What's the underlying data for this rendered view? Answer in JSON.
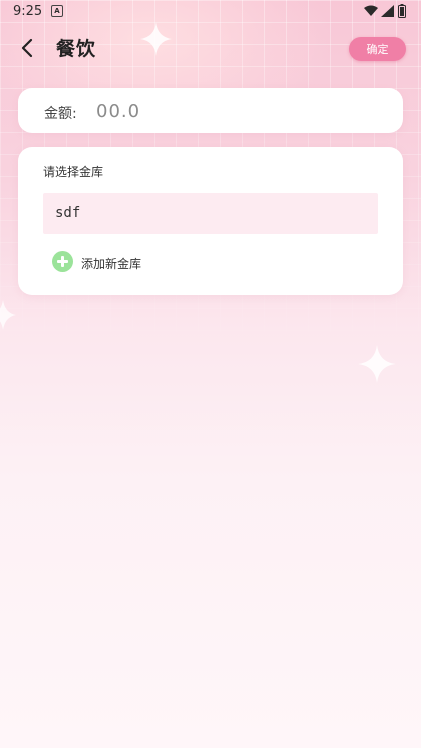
{
  "status_bar": {
    "time": "9:25",
    "notification_icon": "a-notification-icon",
    "wifi_icon": "wifi-icon",
    "signal_icon": "signal-icon",
    "battery_icon": "battery-icon"
  },
  "header": {
    "back_icon": "chevron-left-icon",
    "title": "餐饮",
    "confirm_label": "确定"
  },
  "amount": {
    "label": "金额:",
    "placeholder": "00.0",
    "value": ""
  },
  "vault": {
    "heading": "请选择金库",
    "items": [
      {
        "label": "sdf",
        "selected": true
      }
    ],
    "add_label": "添加新金库",
    "add_icon": "plus-circle-icon"
  },
  "colors": {
    "accent": "#f07fa6",
    "add_green": "#9be39a",
    "selected_item_bg": "#fdebf1"
  }
}
